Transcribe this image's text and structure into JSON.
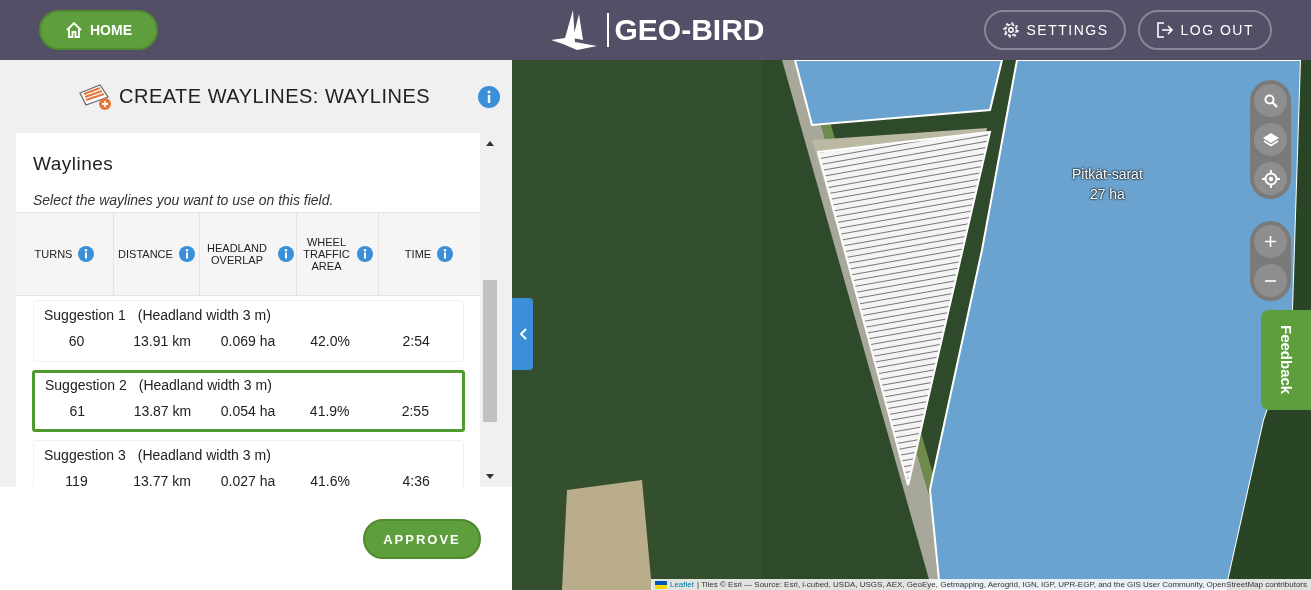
{
  "header": {
    "home_button": "HOME",
    "logo_text": "GEO-BIRD",
    "buttons": [
      {
        "label": "SETTINGS",
        "kind": "settings"
      },
      {
        "label": "LOG OUT",
        "kind": "logout"
      }
    ]
  },
  "panel": {
    "title": "CREATE WAYLINES: WAYLINES",
    "card_title": "Waylines",
    "instruction": "Select the waylines you want to use on this field.",
    "columns": [
      {
        "label": "TURNS",
        "kind": "narrow"
      },
      {
        "label": "DISTANCE",
        "kind": "narrow"
      },
      {
        "label": "HEADLAND OVERLAP",
        "kind": "wrap2"
      },
      {
        "label": "WHEEL TRAFFIC AREA",
        "kind": "wrap3"
      },
      {
        "label": "TIME",
        "kind": "narrow"
      }
    ],
    "suggestions": [
      {
        "name": "Suggestion 1",
        "note": "(Headland width 3 m)",
        "values": [
          "60",
          "13.91 km",
          "0.069 ha",
          "42.0%",
          "2:54"
        ],
        "selected": false
      },
      {
        "name": "Suggestion 2",
        "note": "(Headland width 3 m)",
        "values": [
          "61",
          "13.87 km",
          "0.054 ha",
          "41.9%",
          "2:55"
        ],
        "selected": true
      },
      {
        "name": "Suggestion 3",
        "note": "(Headland width 3 m)",
        "values": [
          "119",
          "13.77 km",
          "0.027 ha",
          "41.6%",
          "4:36"
        ],
        "selected": false
      }
    ],
    "approve_button": "APPROVE"
  },
  "map": {
    "field_label": {
      "name": "Pitkät-sarat",
      "area": "27 ha"
    },
    "feedback_tab": "Feedback",
    "attribution": {
      "link": "Leaflet",
      "text": "| Tiles © Esri — Source: Esri, i-cubed, USDA, USGS, AEX, GeoEye, Getmapping, Aerogrid, IGN, IGP, UPR-EGP, and the GIS User Community, OpenStreetMap contributors"
    }
  }
}
